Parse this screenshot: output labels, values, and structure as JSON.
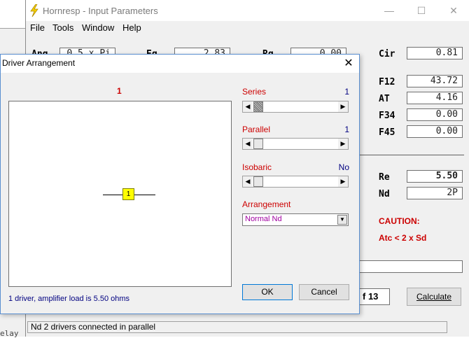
{
  "main_window": {
    "title": "Hornresp - Input Parameters",
    "controls": {
      "minimize": "—",
      "maximize": "☐",
      "close": "✕"
    },
    "menu": [
      "File",
      "Tools",
      "Window",
      "Help"
    ],
    "top_fields": {
      "ang_label": "Ang",
      "ang_value": "0.5 x Pi",
      "eg_label": "Eg",
      "eg_value": "2.83",
      "rg_label": "Rg",
      "rg_value": "0.00"
    },
    "right_fields": [
      {
        "label": "Cir",
        "value": "0.81"
      },
      {
        "label": "F12",
        "value": "43.72"
      },
      {
        "label": "AT",
        "value": "4.16"
      },
      {
        "label": "F34",
        "value": "0.00"
      },
      {
        "label": "F45",
        "value": "0.00"
      }
    ],
    "driver_fields": [
      {
        "label": "Re",
        "value": "5.50"
      },
      {
        "label": "Nd",
        "value": "2P"
      }
    ],
    "caution_title": "CAUTION:",
    "caution_text": "Atc < 2 x Sd",
    "page_indicator": "f 13",
    "calculate_label": "Calculate",
    "status_text": "Nd   2 drivers connected in parallel",
    "bottom_partial": "elay"
  },
  "dialog": {
    "title": "Driver Arrangement",
    "close": "✕",
    "count": "1",
    "driver_label": "1",
    "status": "1 driver, amplifier load is 5.50 ohms",
    "series": {
      "label": "Series",
      "value": "1"
    },
    "parallel": {
      "label": "Parallel",
      "value": "1"
    },
    "isobaric": {
      "label": "Isobaric",
      "value": "No"
    },
    "arrangement": {
      "label": "Arrangement",
      "selected": "Normal Nd"
    },
    "ok_label": "OK",
    "cancel_label": "Cancel",
    "arrow_left": "◀",
    "arrow_right": "▶",
    "dropdown_arrow": "▼"
  }
}
